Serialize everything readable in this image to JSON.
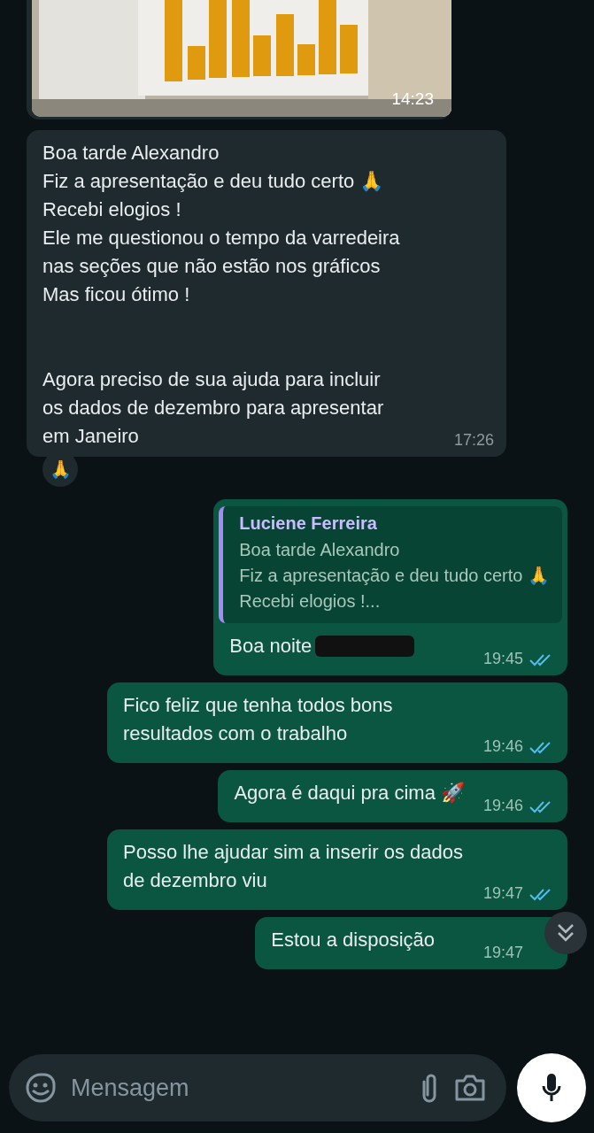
{
  "messages": [
    {
      "outgoing": false,
      "time": "14:23"
    },
    {
      "kind": "text",
      "outgoing": false,
      "text": "Boa tarde Alexandro\nFiz a apresentação e deu tudo certo 🙏\nRecebi elogios !\nEle me questionou o tempo da varredeira nas seções que não estão nos gráficos\nMas ficou ótimo !\n\n\nAgora preciso de sua ajuda para incluir os dados de dezembro para apresentar em Janeiro",
      "time": "17:26",
      "reaction": "🙏"
    },
    {
      "kind": "quote",
      "outgoing": true,
      "quote_author": "Luciene Ferreira",
      "quote_text": "Boa tarde Alexandro\nFiz a apresentação e deu tudo certo 🙏\nRecebi elogios !...",
      "text": "Boa noite",
      "redacted": true,
      "time": "19:45",
      "read": true
    },
    {
      "kind": "text",
      "outgoing": true,
      "text": "Fico feliz que tenha todos bons resultados com o trabalho",
      "time": "19:46",
      "read": true
    },
    {
      "kind": "text",
      "outgoing": true,
      "text": "Agora é daqui pra cima 🚀",
      "time": "19:46",
      "read": true
    },
    {
      "kind": "text",
      "outgoing": true,
      "text": "Posso lhe ajudar sim a inserir os dados de dezembro viu",
      "time": "19:47",
      "read": true
    },
    {
      "kind": "text",
      "outgoing": true,
      "text": "Estou a disposição",
      "time": "19:47"
    }
  ],
  "composer": {
    "placeholder": "Mensagem"
  }
}
